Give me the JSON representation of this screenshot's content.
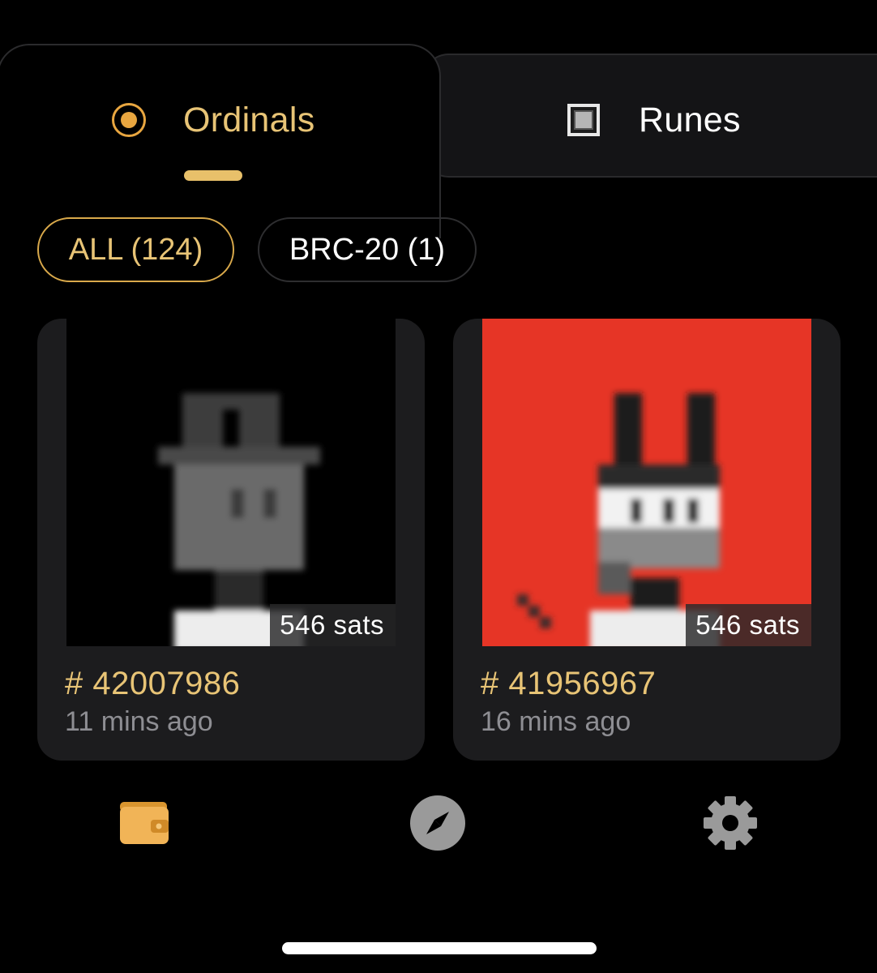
{
  "tabs": [
    {
      "label": "Ordinals",
      "icon": "radio-selected-icon",
      "active": true
    },
    {
      "label": "Runes",
      "icon": "square-checkbox-icon",
      "active": false
    }
  ],
  "filters": [
    {
      "label": "ALL (124)",
      "selected": true
    },
    {
      "label": "BRC-20 (1)",
      "selected": false
    }
  ],
  "cards": [
    {
      "id": "# 42007986",
      "time": "11 mins ago",
      "price": "546 sats",
      "image_bg": "#000000",
      "image": "blurred-robot-avatar"
    },
    {
      "id": "# 41956967",
      "time": "16 mins ago",
      "price": "546 sats",
      "image_bg": "#e63526",
      "image": "blurred-bunny-avatar"
    }
  ],
  "bottom_nav": [
    {
      "icon": "wallet-icon",
      "active": true
    },
    {
      "icon": "compass-icon",
      "active": false
    },
    {
      "icon": "gear-icon",
      "active": false
    }
  ],
  "colors": {
    "accent": "#e8c476",
    "accent_strong": "#e8a640",
    "background": "#000000",
    "card": "#1c1c1e",
    "muted_text": "#8e8e93"
  }
}
